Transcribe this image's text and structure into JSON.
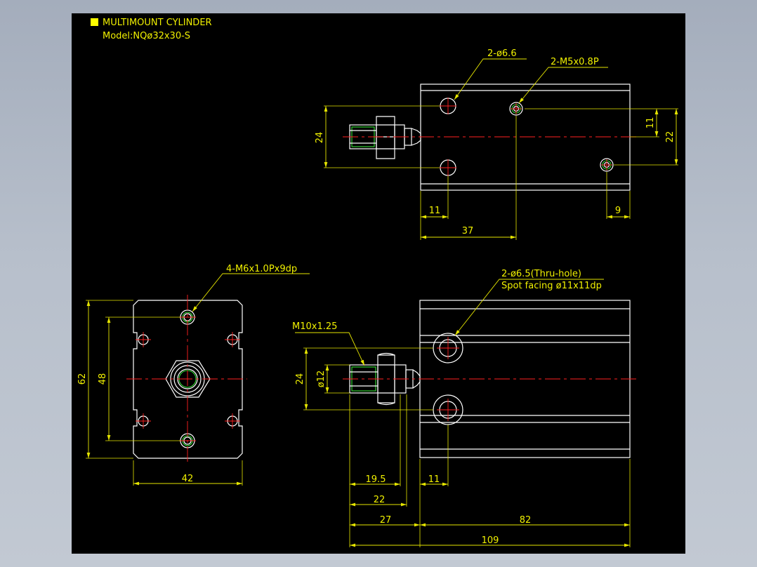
{
  "title": {
    "line1": "MULTIMOUNT CYLINDER",
    "line2": "Model:NQø32x30-S",
    "marker_color": "#ffff00"
  },
  "colors": {
    "background": "#000000",
    "outline": "#ffffff",
    "thread": "#35e035",
    "centerline": "#ff2020",
    "dimension": "#f0f000"
  },
  "top_view": {
    "callout_holes": "2-ø6.6",
    "callout_ports": "2-M5x0.8P",
    "dim_height": "24",
    "dim_port_offset": "11",
    "dim_port_spacing": "22",
    "dim_hole_offset": "11",
    "dim_port_edge": "9",
    "dim_port_distance": "37"
  },
  "end_view": {
    "callout_taps": "4-M6x1.0Px9dp",
    "dim_height": "62",
    "dim_tap_pitch": "48",
    "dim_width": "42"
  },
  "side_view": {
    "callout_holes_line1": "2-ø6.5(Thru-hole)",
    "callout_holes_line2": "Spot facing ø11x11dp",
    "callout_thread": "M10x1.25",
    "dim_rod_dia": "ø12",
    "dim_height": "24",
    "dim_thread_len": "19.5",
    "dim_nut_len": "22",
    "dim_rod_len": "27",
    "dim_hole_offset": "11",
    "dim_body_len": "82",
    "dim_total_len": "109"
  }
}
